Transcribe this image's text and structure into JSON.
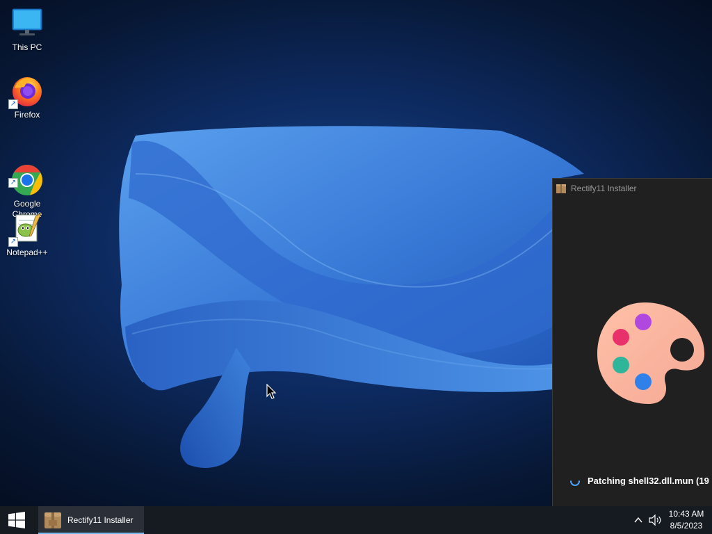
{
  "desktop": {
    "icons": [
      {
        "label": "This PC",
        "icon": "computer-icon"
      },
      {
        "label": "Firefox",
        "icon": "firefox-icon"
      },
      {
        "label": "Google\nChrome",
        "icon": "chrome-icon"
      },
      {
        "label": "Notepad++",
        "icon": "notepad-plus-plus-icon"
      }
    ]
  },
  "installer": {
    "title": "Rectify11 Installer",
    "status": "Patching shell32.dll.mun (19"
  },
  "taskbar": {
    "running_app": "Rectify11 Installer",
    "time": "10:43 AM",
    "date": "8/5/2023"
  },
  "colors": {
    "accent": "#76b9ed",
    "wallpaper_wave": "#3b78d6",
    "window_bg": "#202020",
    "taskbar_bg": "#161b22"
  }
}
